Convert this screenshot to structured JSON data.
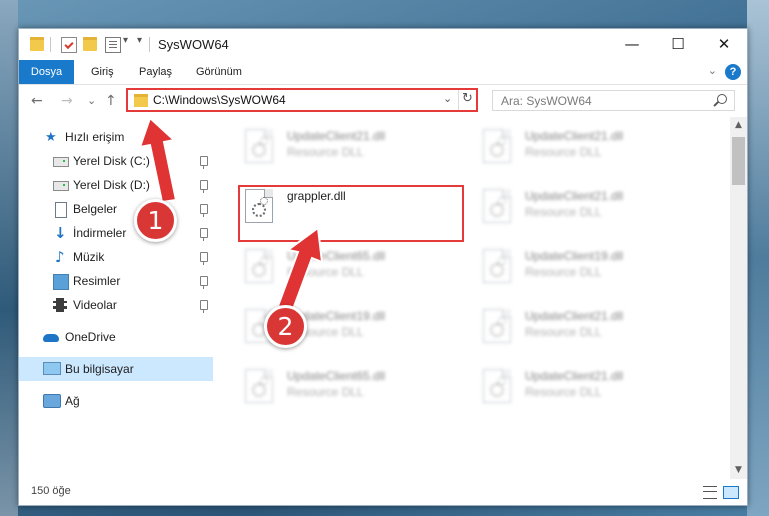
{
  "titlebar": {
    "title": "SysWOW64",
    "qa_dropdown_icon": "▾",
    "minimize": "—",
    "maximize": "☐",
    "close": "✕"
  },
  "ribbon": {
    "tabs": [
      "Dosya",
      "Giriş",
      "Paylaş",
      "Görünüm"
    ],
    "collapse_icon": "⌄",
    "help_icon": "?"
  },
  "navbar": {
    "back": "←",
    "forward": "→",
    "recent": "⌄",
    "up": "↑",
    "address": "C:\\Windows\\SysWOW64",
    "address_dropdown": "⌄",
    "refresh": "↻",
    "search_placeholder": "Ara: SysWOW64"
  },
  "sidebar": {
    "items": [
      {
        "label": "Hızlı erişim",
        "icon": "star-icon"
      },
      {
        "label": "Yerel Disk (C:)",
        "icon": "drive-icon"
      },
      {
        "label": "Yerel Disk (D:)",
        "icon": "drive-icon"
      },
      {
        "label": "Belgeler",
        "icon": "documents-icon"
      },
      {
        "label": "İndirmeler",
        "icon": "downloads-icon"
      },
      {
        "label": "Müzik",
        "icon": "music-icon"
      },
      {
        "label": "Resimler",
        "icon": "pictures-icon"
      },
      {
        "label": "Videolar",
        "icon": "videos-icon"
      },
      {
        "label": "OneDrive",
        "icon": "onedrive-icon"
      },
      {
        "label": "Bu bilgisayar",
        "icon": "this-pc-icon"
      },
      {
        "label": "Ağ",
        "icon": "network-icon"
      }
    ]
  },
  "files": [
    {
      "name": "UpdateClient21.dll",
      "type": "Resource DLL"
    },
    {
      "name": "UpdateClient21.dll",
      "type": "Resource DLL"
    },
    {
      "name": "grappler.dll",
      "type": ""
    },
    {
      "name": "UpdateClient21.dll",
      "type": "Resource DLL"
    },
    {
      "name": "UpdateClient65.dll",
      "type": "Resource DLL"
    },
    {
      "name": "UpdateClient19.dll",
      "type": "Resource DLL"
    },
    {
      "name": "UpdateClient19.dll",
      "type": "Resource DLL"
    },
    {
      "name": "UpdateClient21.dll",
      "type": "Resource DLL"
    },
    {
      "name": "UpdateClient65.dll",
      "type": "Resource DLL"
    },
    {
      "name": "UpdateClient21.dll",
      "type": "Resource DLL"
    }
  ],
  "scroll": {
    "up": "▲",
    "down": "▼"
  },
  "status": {
    "item_count": "150 öğe"
  },
  "callouts": {
    "first": "1",
    "second": "2"
  },
  "colors": {
    "accent": "#1979ca",
    "highlight_red": "#e53a3a",
    "callout_red": "#d93636",
    "selection": "#cce8ff"
  }
}
